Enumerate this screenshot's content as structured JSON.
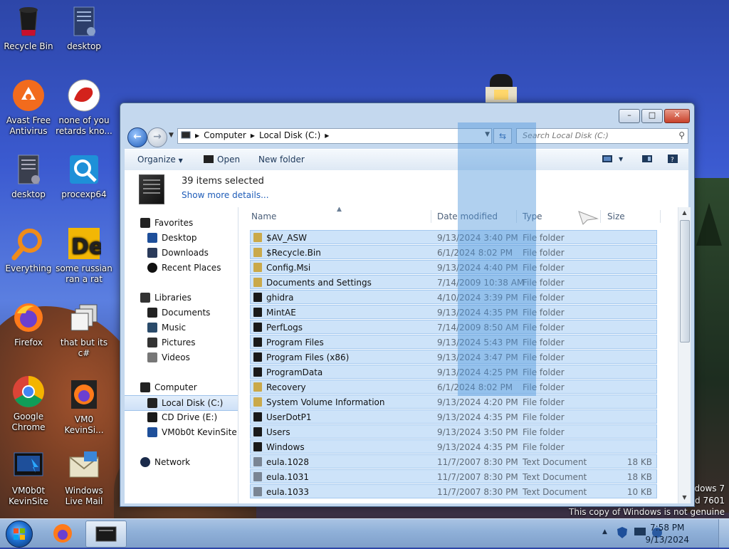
{
  "desktop": {
    "icons": [
      {
        "label": "Recycle Bin"
      },
      {
        "label": "desktop"
      },
      {
        "label": "Avast Free Antivirus"
      },
      {
        "label": "none of you retards kno..."
      },
      {
        "label": "desktop"
      },
      {
        "label": "procexp64"
      },
      {
        "label": "Everything"
      },
      {
        "label": "some russian ran a rat"
      },
      {
        "label": "Firefox"
      },
      {
        "label": "that but its c#"
      },
      {
        "label": "Google Chrome"
      },
      {
        "label": "VM0 KevinSi..."
      },
      {
        "label": "VM0b0t KevinSite"
      },
      {
        "label": "Windows Live Mail"
      }
    ],
    "watermark": {
      "line1": "indows 7",
      "line2": "uild 7601",
      "line3": "This copy of Windows is not genuine"
    }
  },
  "window": {
    "address": {
      "crumbs": [
        "Computer",
        "Local Disk (C:)"
      ]
    },
    "search": {
      "placeholder": "Search Local Disk (C:)"
    },
    "toolbar": {
      "organize": "Organize",
      "open": "Open",
      "new_folder": "New folder"
    },
    "details": {
      "count": "39 items selected",
      "more": "Show more details..."
    },
    "nav": {
      "favorites": "Favorites",
      "desktop": "Desktop",
      "downloads": "Downloads",
      "recent": "Recent Places",
      "libraries": "Libraries",
      "documents": "Documents",
      "music": "Music",
      "pictures": "Pictures",
      "videos": "Videos",
      "computer": "Computer",
      "local_disk": "Local Disk (C:)",
      "cd_drive": "CD Drive (E:)",
      "vm": "VM0b0t KevinSite",
      "network": "Network"
    },
    "columns": {
      "name": "Name",
      "date": "Date modified",
      "type": "Type",
      "size": "Size"
    },
    "files": [
      {
        "name": "$AV_ASW",
        "date": "9/13/2024 3:40 PM",
        "type": "File folder",
        "size": "",
        "icon": "locked-folder"
      },
      {
        "name": "$Recycle.Bin",
        "date": "6/1/2024 8:02 PM",
        "type": "File folder",
        "size": "",
        "icon": "locked-folder"
      },
      {
        "name": "Config.Msi",
        "date": "9/13/2024 4:40 PM",
        "type": "File folder",
        "size": "",
        "icon": "locked-folder"
      },
      {
        "name": "Documents and Settings",
        "date": "7/14/2009 10:38 AM",
        "type": "File folder",
        "size": "",
        "icon": "locked-folder"
      },
      {
        "name": "ghidra",
        "date": "4/10/2024 3:39 PM",
        "type": "File folder",
        "size": "",
        "icon": "folder"
      },
      {
        "name": "MintAE",
        "date": "9/13/2024 4:35 PM",
        "type": "File folder",
        "size": "",
        "icon": "folder"
      },
      {
        "name": "PerfLogs",
        "date": "7/14/2009 8:50 AM",
        "type": "File folder",
        "size": "",
        "icon": "folder"
      },
      {
        "name": "Program Files",
        "date": "9/13/2024 5:43 PM",
        "type": "File folder",
        "size": "",
        "icon": "folder"
      },
      {
        "name": "Program Files (x86)",
        "date": "9/13/2024 3:47 PM",
        "type": "File folder",
        "size": "",
        "icon": "folder"
      },
      {
        "name": "ProgramData",
        "date": "9/13/2024 4:25 PM",
        "type": "File folder",
        "size": "",
        "icon": "folder"
      },
      {
        "name": "Recovery",
        "date": "6/1/2024 8:02 PM",
        "type": "File folder",
        "size": "",
        "icon": "locked-folder"
      },
      {
        "name": "System Volume Information",
        "date": "9/13/2024 4:20 PM",
        "type": "File folder",
        "size": "",
        "icon": "locked-folder"
      },
      {
        "name": "UserDotP1",
        "date": "9/13/2024 4:35 PM",
        "type": "File folder",
        "size": "",
        "icon": "folder"
      },
      {
        "name": "Users",
        "date": "9/13/2024 3:50 PM",
        "type": "File folder",
        "size": "",
        "icon": "folder"
      },
      {
        "name": "Windows",
        "date": "9/13/2024 4:35 PM",
        "type": "File folder",
        "size": "",
        "icon": "folder"
      },
      {
        "name": "eula.1028",
        "date": "11/7/2007 8:30 PM",
        "type": "Text Document",
        "size": "18 KB",
        "icon": "text-file"
      },
      {
        "name": "eula.1031",
        "date": "11/7/2007 8:30 PM",
        "type": "Text Document",
        "size": "18 KB",
        "icon": "text-file"
      },
      {
        "name": "eula.1033",
        "date": "11/7/2007 8:30 PM",
        "type": "Text Document",
        "size": "10 KB",
        "icon": "text-file"
      }
    ]
  },
  "taskbar": {
    "time": "7:58 PM",
    "date": "9/13/2024"
  },
  "colors": {
    "selection": "#cde3f9",
    "selection_border": "#a5c9ef",
    "link": "#1e5cb8"
  }
}
